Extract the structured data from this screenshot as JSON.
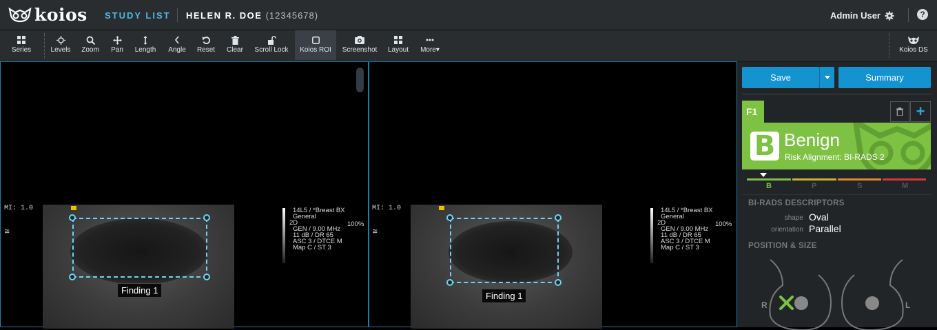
{
  "header": {
    "logo_text": "koios",
    "study_list": "STUDY LIST",
    "patient_name": "HELEN R. DOE",
    "patient_id": "(12345678)",
    "user_name": "Admin User",
    "help_glyph": "?"
  },
  "toolbar": {
    "series": "Series",
    "levels": "Levels",
    "zoom": "Zoom",
    "pan": "Pan",
    "length": "Length",
    "angle": "Angle",
    "reset": "Reset",
    "clear": "Clear",
    "scroll_lock": "Scroll Lock",
    "koios_roi": "Koios ROI",
    "screenshot": "Screenshot",
    "layout": "Layout",
    "more": "More▾",
    "koios_ds": "Koios DS"
  },
  "viewports": [
    {
      "mi": "MI:  1.0",
      "approx": "≅",
      "info": [
        "14L5 / *Breast BX",
        "General",
        "2D",
        "GEN / 9.00 MHz",
        "11 dB / DR 65",
        "ASC 3 / DTCE M",
        "Map C / ST 3"
      ],
      "percent": "100%",
      "finding_label": "Finding 1"
    },
    {
      "mi": "MI:  1.0",
      "approx": "≅",
      "info": [
        "14L5 / *Breast BX",
        "General",
        "2D",
        "GEN / 9.00 MHz",
        "11 dB / DR 65",
        "ASC 3 / DTCE M",
        "Map C / ST 3"
      ],
      "percent": "100%",
      "finding_label": "Finding 1"
    }
  ],
  "panel": {
    "save_label": "Save",
    "summary_label": "Summary",
    "finding_tab": "F1",
    "classification_letter": "B",
    "classification": "Benign",
    "risk_alignment": "Risk Alignment: BI-RADS 2",
    "risk_scale": [
      "B",
      "P",
      "S",
      "M"
    ],
    "risk_colors": [
      "#7dc242",
      "#c9b52d",
      "#e08a2a",
      "#d23a3a"
    ],
    "birads_heading": "BI-RADS DESCRIPTORS",
    "descriptors": [
      {
        "key": "shape",
        "value": "Oval"
      },
      {
        "key": "orientation",
        "value": "Parallel"
      }
    ],
    "position_heading": "POSITION & SIZE",
    "breast_right_label": "R",
    "breast_left_label": "L",
    "accent_color": "#1493d1",
    "benign_color": "#7dc242"
  }
}
